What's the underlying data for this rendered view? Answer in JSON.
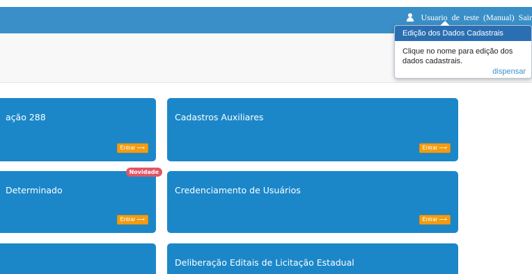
{
  "header": {
    "user_words": [
      "Usuario",
      "de",
      "teste",
      "(Manual)"
    ],
    "logout_label": "Sair"
  },
  "popover": {
    "title": "Edição dos Dados Cadastrais",
    "body": "Clique no nome para edição dos dados cadastrais.",
    "dismiss_label": "dispensar"
  },
  "cards": {
    "card1": {
      "title": "ação 288",
      "button": "Entrar ⟶"
    },
    "card2": {
      "title": "Cadastros Auxiliares",
      "button": "Entrar ⟶"
    },
    "card3": {
      "title": "Determinado",
      "button": "Entrar ⟶",
      "badge": "Novidade"
    },
    "card4": {
      "title": "Credenciamento de Usuários",
      "button": "Entrar ⟶"
    },
    "card5": {
      "title": ""
    },
    "card6": {
      "title": "Deliberação Editais de Licitação Estadual"
    }
  },
  "colors": {
    "topbar": "#3a8fc8",
    "card": "#1b87c9",
    "button": "#f39c12",
    "badge": "#e05666",
    "popover_header": "#2b6fb3"
  },
  "icons": {
    "user": "user-icon"
  }
}
